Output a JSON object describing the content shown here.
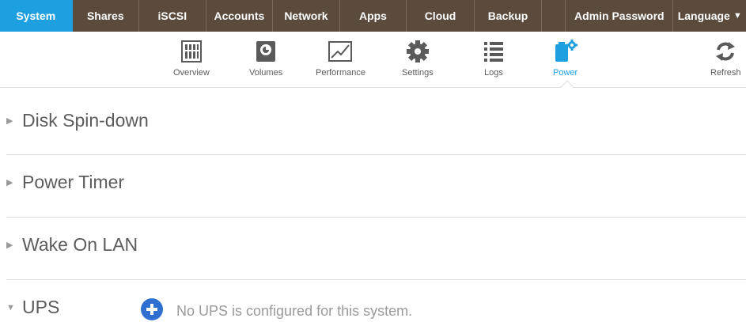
{
  "topnav": {
    "tabs": [
      {
        "label": "System",
        "active": true
      },
      {
        "label": "Shares"
      },
      {
        "label": "iSCSI"
      },
      {
        "label": "Accounts"
      },
      {
        "label": "Network"
      },
      {
        "label": "Apps"
      },
      {
        "label": "Cloud"
      },
      {
        "label": "Backup"
      },
      {
        "label": ""
      },
      {
        "label": "Admin Password"
      },
      {
        "label": "Language"
      }
    ],
    "active_color": "#1ea0e0",
    "bar_color": "#5a4b3d"
  },
  "subnav": {
    "items": [
      {
        "label": "Overview",
        "icon": "overview-icon"
      },
      {
        "label": "Volumes",
        "icon": "volumes-icon"
      },
      {
        "label": "Performance",
        "icon": "performance-icon"
      },
      {
        "label": "Settings",
        "icon": "gear-icon"
      },
      {
        "label": "Logs",
        "icon": "list-icon"
      },
      {
        "label": "Power",
        "icon": "power-icon",
        "active": true
      },
      {
        "label": "Refresh",
        "icon": "refresh-icon"
      }
    ]
  },
  "sections": [
    {
      "title": "Disk Spin-down",
      "expanded": false
    },
    {
      "title": "Power Timer",
      "expanded": false
    },
    {
      "title": "Wake On LAN",
      "expanded": false
    },
    {
      "title": "UPS",
      "expanded": true
    }
  ],
  "ups": {
    "message": "No UPS is configured for this system.",
    "add_icon": "plus-circle-icon"
  }
}
